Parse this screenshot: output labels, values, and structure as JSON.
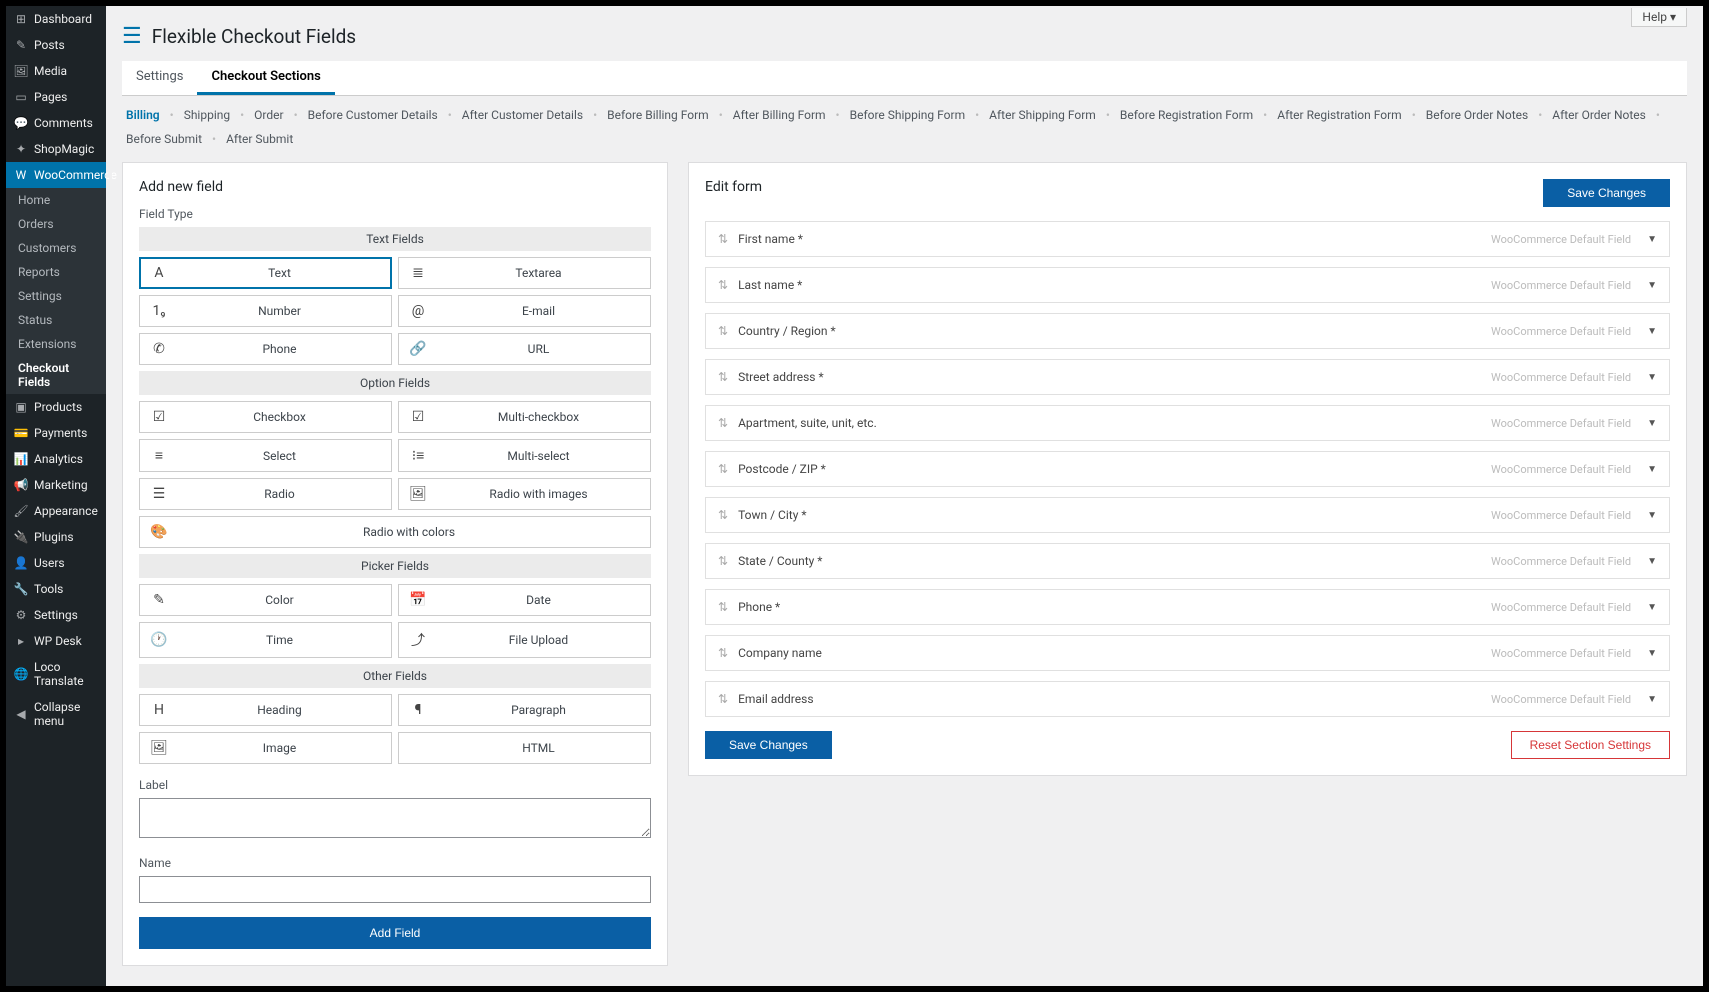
{
  "help_label": "Help",
  "page_title": "Flexible Checkout Fields",
  "sidebar": {
    "items": [
      {
        "label": "Dashboard",
        "icon": "⊞"
      },
      {
        "label": "Posts",
        "icon": "✎"
      },
      {
        "label": "Media",
        "icon": "🖼"
      },
      {
        "label": "Pages",
        "icon": "▭"
      },
      {
        "label": "Comments",
        "icon": "💬"
      },
      {
        "label": "ShopMagic",
        "icon": "✦"
      },
      {
        "label": "WooCommerce",
        "icon": "W",
        "active": true
      },
      {
        "label": "Products",
        "icon": "▣"
      },
      {
        "label": "Payments",
        "icon": "💳"
      },
      {
        "label": "Analytics",
        "icon": "📊"
      },
      {
        "label": "Marketing",
        "icon": "📢"
      },
      {
        "label": "Appearance",
        "icon": "🖌"
      },
      {
        "label": "Plugins",
        "icon": "🔌"
      },
      {
        "label": "Users",
        "icon": "👤"
      },
      {
        "label": "Tools",
        "icon": "🔧"
      },
      {
        "label": "Settings",
        "icon": "⚙"
      },
      {
        "label": "WP Desk",
        "icon": "▸"
      },
      {
        "label": "Loco Translate",
        "icon": "🌐"
      },
      {
        "label": "Collapse menu",
        "icon": "◀"
      }
    ],
    "sub": [
      {
        "label": "Home"
      },
      {
        "label": "Orders"
      },
      {
        "label": "Customers"
      },
      {
        "label": "Reports"
      },
      {
        "label": "Settings"
      },
      {
        "label": "Status"
      },
      {
        "label": "Extensions"
      },
      {
        "label": "Checkout Fields",
        "active": true
      }
    ]
  },
  "tabs": [
    {
      "label": "Settings"
    },
    {
      "label": "Checkout Sections",
      "active": true
    }
  ],
  "sections": [
    {
      "label": "Billing",
      "active": true
    },
    {
      "label": "Shipping"
    },
    {
      "label": "Order"
    },
    {
      "label": "Before Customer Details"
    },
    {
      "label": "After Customer Details"
    },
    {
      "label": "Before Billing Form"
    },
    {
      "label": "After Billing Form"
    },
    {
      "label": "Before Shipping Form"
    },
    {
      "label": "After Shipping Form"
    },
    {
      "label": "Before Registration Form"
    },
    {
      "label": "After Registration Form"
    },
    {
      "label": "Before Order Notes"
    },
    {
      "label": "After Order Notes"
    },
    {
      "label": "Before Submit"
    },
    {
      "label": "After Submit"
    }
  ],
  "left": {
    "title": "Add new field",
    "field_type_label": "Field Type",
    "groups": [
      {
        "header": "Text Fields",
        "rows": [
          [
            {
              "label": "Text",
              "icon": "A",
              "selected": true
            },
            {
              "label": "Textarea",
              "icon": "≣"
            }
          ],
          [
            {
              "label": "Number",
              "icon": "1₉"
            },
            {
              "label": "E-mail",
              "icon": "@"
            }
          ],
          [
            {
              "label": "Phone",
              "icon": "✆"
            },
            {
              "label": "URL",
              "icon": "🔗"
            }
          ]
        ]
      },
      {
        "header": "Option Fields",
        "rows": [
          [
            {
              "label": "Checkbox",
              "icon": "☑"
            },
            {
              "label": "Multi-checkbox",
              "icon": "☑"
            }
          ],
          [
            {
              "label": "Select",
              "icon": "≡"
            },
            {
              "label": "Multi-select",
              "icon": "⁝≡"
            }
          ],
          [
            {
              "label": "Radio",
              "icon": "☰"
            },
            {
              "label": "Radio with images",
              "icon": "🖼"
            }
          ],
          [
            {
              "label": "Radio with colors",
              "icon": "🎨"
            }
          ]
        ]
      },
      {
        "header": "Picker Fields",
        "rows": [
          [
            {
              "label": "Color",
              "icon": "✎"
            },
            {
              "label": "Date",
              "icon": "📅"
            }
          ],
          [
            {
              "label": "Time",
              "icon": "🕐"
            },
            {
              "label": "File Upload",
              "icon": "⤴"
            }
          ]
        ]
      },
      {
        "header": "Other Fields",
        "rows": [
          [
            {
              "label": "Heading",
              "icon": "H"
            },
            {
              "label": "Paragraph",
              "icon": "¶"
            }
          ],
          [
            {
              "label": "Image",
              "icon": "🖼"
            },
            {
              "label": "HTML",
              "icon": "</>"
            }
          ]
        ]
      }
    ],
    "label_label": "Label",
    "name_label": "Name",
    "add_field": "Add Field"
  },
  "right": {
    "title": "Edit form",
    "save": "Save Changes",
    "reset": "Reset Section Settings",
    "default_badge": "WooCommerce Default Field",
    "fields": [
      {
        "label": "First name *"
      },
      {
        "label": "Last name *"
      },
      {
        "label": "Country / Region *"
      },
      {
        "label": "Street address *"
      },
      {
        "label": "Apartment, suite, unit, etc."
      },
      {
        "label": "Postcode / ZIP *"
      },
      {
        "label": "Town / City *"
      },
      {
        "label": "State / County *"
      },
      {
        "label": "Phone *"
      },
      {
        "label": "Company name"
      },
      {
        "label": "Email address"
      }
    ]
  }
}
